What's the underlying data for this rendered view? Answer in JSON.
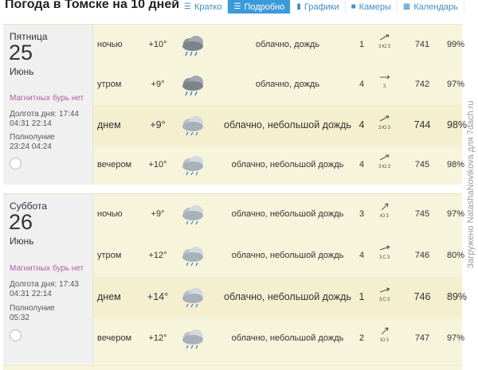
{
  "header": {
    "title": "Погода в Томске на 10 дней",
    "tabs": [
      {
        "label": "Кратко",
        "icon": "list-icon",
        "active": false
      },
      {
        "label": "Подробно",
        "icon": "list-icon",
        "active": true
      },
      {
        "label": "Графики",
        "icon": "chart-icon",
        "active": false
      },
      {
        "label": "Камеры",
        "icon": "camera-icon",
        "active": false
      },
      {
        "label": "Календарь",
        "icon": "calendar-icon",
        "active": false
      }
    ]
  },
  "colors": {
    "accent": "#3d9ad9",
    "day_bg": "#f7f4dc",
    "magnetic": "#b05fa3"
  },
  "days": [
    {
      "weekday": "Пятница",
      "date": "25",
      "month": "Июнь",
      "magnetic": "Магнитных бурь нет",
      "daylight_label": "Долгота дня: 17:44",
      "daylight_times": "04:31 22:14",
      "moon_label": "Полнолуние",
      "moon_times": "23:24 04:24",
      "rows": [
        {
          "period": "ночью",
          "temp": "+10°",
          "icon": "cloud-rain-icon",
          "desc": "облачно, дождь",
          "wind": "1",
          "wind_dir": "ЗЮЗ",
          "pressure": "741",
          "humidity": "99%"
        },
        {
          "period": "утром",
          "temp": "+9°",
          "icon": "cloud-rain-icon",
          "desc": "облачно, дождь",
          "wind": "4",
          "wind_dir": "З",
          "pressure": "742",
          "humidity": "97%"
        },
        {
          "period": "днем",
          "temp": "+9°",
          "icon": "cloud-light-rain-icon",
          "desc": "облачно, небольшой дождь",
          "wind": "4",
          "wind_dir": "ЗЮЗ",
          "pressure": "744",
          "humidity": "98%"
        },
        {
          "period": "вечером",
          "temp": "+10°",
          "icon": "cloud-light-rain-icon",
          "desc": "облачно, небольшой дождь",
          "wind": "4",
          "wind_dir": "ЗЮЗ",
          "pressure": "745",
          "humidity": "98%"
        }
      ]
    },
    {
      "weekday": "Суббота",
      "date": "26",
      "month": "Июнь",
      "magnetic": "Магнитных бурь нет",
      "daylight_label": "Долгота дня: 17:43",
      "daylight_times": "04:31 22:14",
      "moon_label": "Полнолуние",
      "moon_times": "05:32",
      "rows": [
        {
          "period": "ночью",
          "temp": "+9°",
          "icon": "cloud-light-rain-icon",
          "desc": "облачно, небольшой дождь",
          "wind": "3",
          "wind_dir": "ЮЗ",
          "pressure": "745",
          "humidity": "97%"
        },
        {
          "period": "утром",
          "temp": "+12°",
          "icon": "cloud-light-rain-icon",
          "desc": "облачно, небольшой дождь",
          "wind": "4",
          "wind_dir": "ЗСЗ",
          "pressure": "746",
          "humidity": "80%"
        },
        {
          "period": "днем",
          "temp": "+14°",
          "icon": "cloud-light-rain-icon",
          "desc": "облачно, небольшой дождь",
          "wind": "1",
          "wind_dir": "ЗСЗ",
          "pressure": "746",
          "humidity": "89%"
        },
        {
          "period": "вечером",
          "temp": "+12°",
          "icon": "cloud-light-rain-icon",
          "desc": "облачно, небольшой дождь",
          "wind": "2",
          "wind_dir": "ЮЗ",
          "pressure": "747",
          "humidity": "97%"
        }
      ]
    }
  ],
  "watermark": "Загружено NatashaNovikova для 7dach.ru"
}
